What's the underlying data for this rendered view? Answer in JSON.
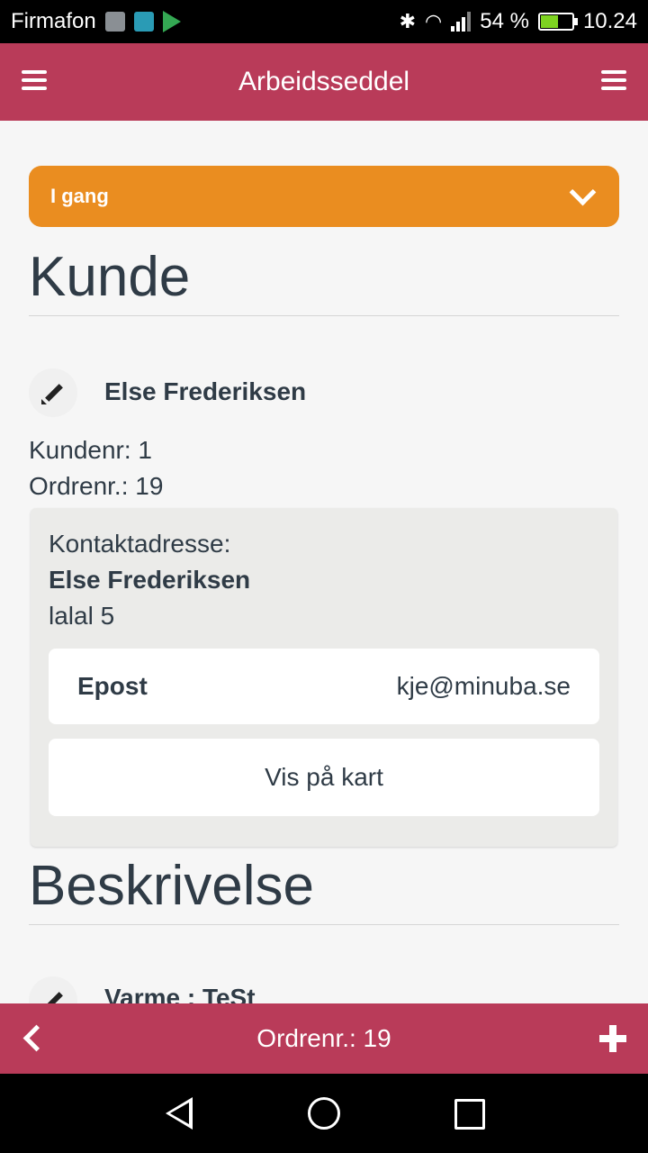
{
  "status_bar": {
    "carrier": "Firmafon",
    "battery": "54 %",
    "battery_level": 0.54,
    "time": "10.24",
    "icons": [
      "gallery-icon",
      "shield-icon",
      "play-store-icon",
      "bluetooth-icon",
      "wifi-icon",
      "signal-icon",
      "battery-icon"
    ]
  },
  "app_bar": {
    "title": "Arbeidsseddel",
    "left_icon": "menu-icon",
    "right_icon": "menu-icon"
  },
  "status_select": {
    "value": "I gang",
    "color": "#ea8d20"
  },
  "customer_section": {
    "title": "Kunde",
    "name": "Else Frederiksen",
    "customer_no": "Kundenr: 1",
    "order_no": "Ordrenr.: 19",
    "contact_card": {
      "label": "Kontaktadresse:",
      "name": "Else Frederiksen",
      "address": "lalal 5",
      "email_label": "Epost",
      "email_value": "kje@minuba.se",
      "map_button": "Vis på kart"
    }
  },
  "description_section": {
    "title": "Beskrivelse",
    "first_item": "Varme : TeSt"
  },
  "bottom_bar": {
    "order_label": "Ordrenr.: 19",
    "left_icon": "chevron-left-icon",
    "right_icon": "plus-icon"
  },
  "colors": {
    "primary": "#b93b59",
    "status_orange": "#ea8d20",
    "text": "#2f3b46"
  }
}
